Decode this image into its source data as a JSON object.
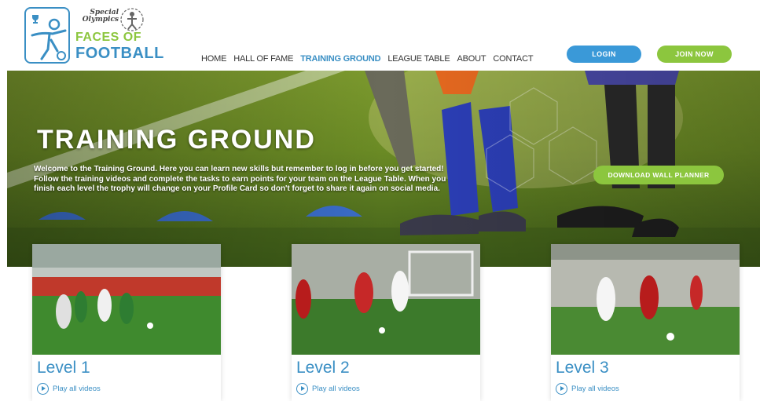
{
  "brand": {
    "special_olympics": "Special Olympics",
    "line1": "FACES OF",
    "line2": "FOOTBALL"
  },
  "nav": {
    "items": [
      {
        "label": "HOME"
      },
      {
        "label": "HALL OF FAME"
      },
      {
        "label": "TRAINING GROUND"
      },
      {
        "label": "LEAGUE TABLE"
      },
      {
        "label": "ABOUT"
      },
      {
        "label": "CONTACT"
      }
    ],
    "active": "TRAINING GROUND"
  },
  "auth": {
    "login_label": "LOGIN",
    "join_label": "JOIN NOW"
  },
  "hero": {
    "title": "TRAINING GROUND",
    "text": "Welcome to the Training Ground. Here you can learn new skills but remember to log in before you get started! Follow the training videos and complete the tasks to earn points for your team on the League Table. When you finish each level the trophy will change on your Profile Card so don't forget to share it again on social media.",
    "download_label": "DOWNLOAD WALL PLANNER"
  },
  "levels": [
    {
      "title": "Level 1",
      "play_label": "Play all videos"
    },
    {
      "title": "Level 2",
      "play_label": "Play all videos"
    },
    {
      "title": "Level 3",
      "play_label": "Play all videos"
    }
  ],
  "colors": {
    "brand_blue": "#3a8fc4",
    "brand_green": "#8cc63e",
    "login_blue": "#3a99d8"
  },
  "icons": {
    "logo": "footballer-logo-icon",
    "emblem": "special-olympics-emblem-icon",
    "play": "play-circle-icon"
  }
}
